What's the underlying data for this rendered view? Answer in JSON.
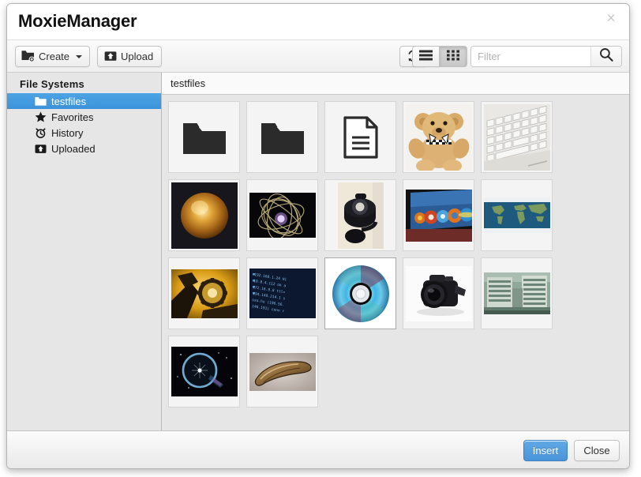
{
  "window": {
    "title": "MoxieManager",
    "close_label": "×"
  },
  "toolbar": {
    "create_label": "Create",
    "upload_label": "Upload",
    "refresh_icon": "refresh-icon",
    "list_view_icon": "list-view-icon",
    "grid_view_icon": "grid-view-icon",
    "active_view": "grid",
    "filter_placeholder": "Filter",
    "filter_value": "",
    "search_icon": "search-icon"
  },
  "sidebar": {
    "title": "File Systems",
    "items": [
      {
        "label": "testfiles",
        "icon": "folder-icon",
        "selected": true
      },
      {
        "label": "Favorites",
        "icon": "star-icon",
        "selected": false
      },
      {
        "label": "History",
        "icon": "clock-icon",
        "selected": false
      },
      {
        "label": "Uploaded",
        "icon": "upload-icon",
        "selected": false
      }
    ]
  },
  "main": {
    "path": "testfiles",
    "tiles": [
      {
        "name": "folder-1",
        "kind": "folder",
        "selected": false
      },
      {
        "name": "folder-2",
        "kind": "folder",
        "selected": false
      },
      {
        "name": "document",
        "kind": "document",
        "selected": false
      },
      {
        "name": "teddy-bear",
        "kind": "image",
        "selected": false
      },
      {
        "name": "keyboard",
        "kind": "image",
        "selected": false
      },
      {
        "name": "golden-orb",
        "kind": "image",
        "selected": false
      },
      {
        "name": "light-trails",
        "kind": "image",
        "selected": false
      },
      {
        "name": "telephone",
        "kind": "image",
        "selected": false
      },
      {
        "name": "browsers",
        "kind": "image",
        "selected": false
      },
      {
        "name": "world-map",
        "kind": "image",
        "selected": false
      },
      {
        "name": "gear",
        "kind": "image",
        "selected": false
      },
      {
        "name": "code-screen",
        "kind": "image",
        "selected": false
      },
      {
        "name": "compact-disc",
        "kind": "image",
        "selected": true
      },
      {
        "name": "camera",
        "kind": "image",
        "selected": false
      },
      {
        "name": "buildings",
        "kind": "image",
        "selected": false
      },
      {
        "name": "blue-ring",
        "kind": "image",
        "selected": false
      },
      {
        "name": "claw",
        "kind": "image",
        "selected": false
      }
    ]
  },
  "footer": {
    "insert_label": "Insert",
    "close_label": "Close"
  },
  "colors": {
    "accent": "#4a95da",
    "selection": "#3a93da",
    "panel": "#e6e6e6"
  }
}
